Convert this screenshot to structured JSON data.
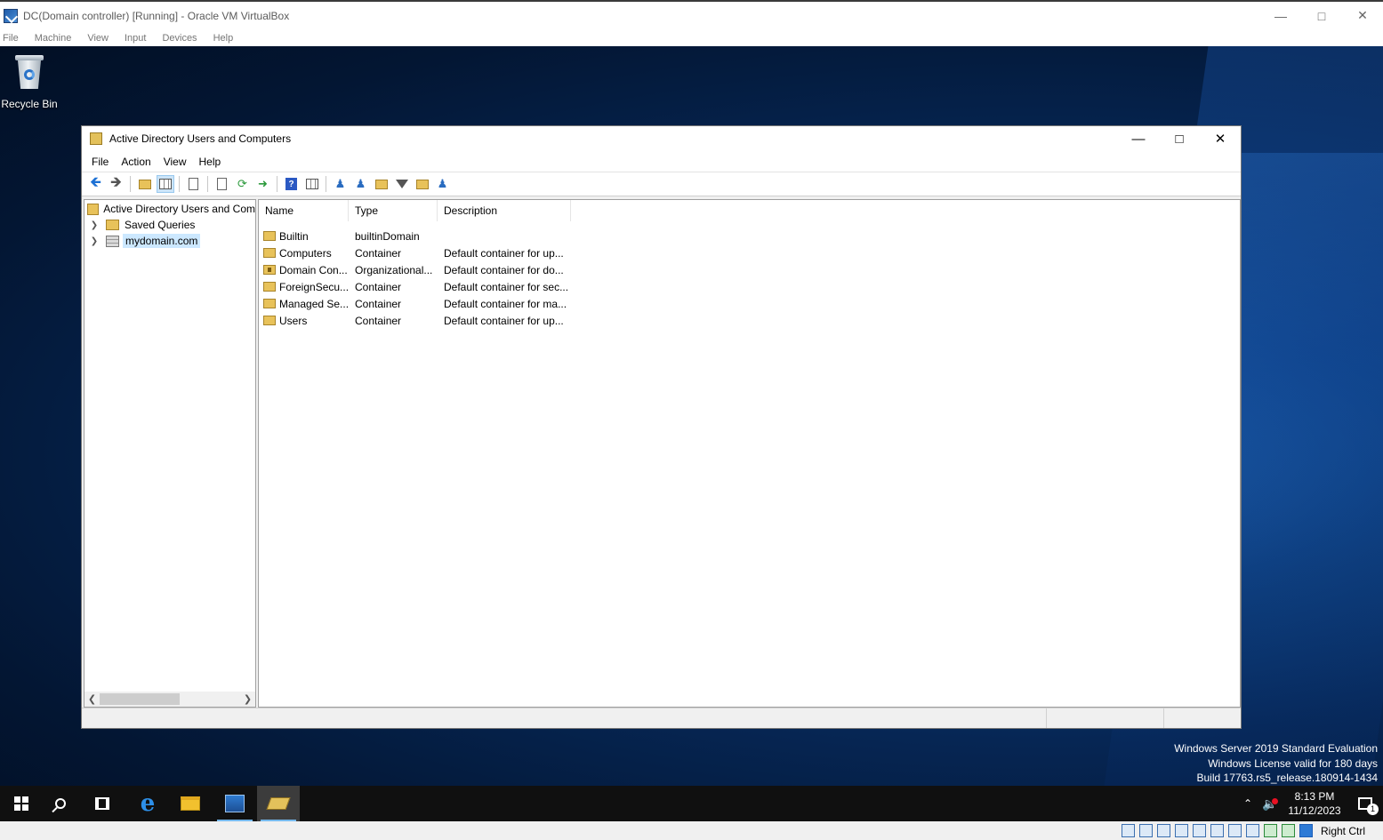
{
  "vbox": {
    "title": "DC(Domain controller)  [Running] - Oracle VM VirtualBox",
    "menu": [
      "File",
      "Machine",
      "View",
      "Input",
      "Devices",
      "Help"
    ],
    "host_key": "Right Ctrl"
  },
  "desktop": {
    "recycle_bin": "Recycle Bin",
    "watermark": {
      "line1": "Windows Server 2019 Standard Evaluation",
      "line2": "Windows License valid for 180 days",
      "line3": "Build 17763.rs5_release.180914-1434"
    }
  },
  "aduc": {
    "title": "Active Directory Users and Computers",
    "menu": [
      "File",
      "Action",
      "View",
      "Help"
    ],
    "tree": {
      "root": "Active Directory Users and Com",
      "items": [
        "Saved Queries",
        "mydomain.com"
      ]
    },
    "columns": [
      "Name",
      "Type",
      "Description"
    ],
    "rows": [
      {
        "name": "Builtin",
        "type": "builtinDomain",
        "description": ""
      },
      {
        "name": "Computers",
        "type": "Container",
        "description": "Default container for up..."
      },
      {
        "name": "Domain Con...",
        "type": "Organizational...",
        "description": "Default container for do..."
      },
      {
        "name": "ForeignSecu...",
        "type": "Container",
        "description": "Default container for sec..."
      },
      {
        "name": "Managed Se...",
        "type": "Container",
        "description": "Default container for ma..."
      },
      {
        "name": "Users",
        "type": "Container",
        "description": "Default container for up..."
      }
    ]
  },
  "taskbar": {
    "time": "8:13 PM",
    "date": "11/12/2023",
    "notification_count": "1"
  },
  "colors": {
    "selection": "#cce8ff",
    "folder": "#e8c25a",
    "taskbar": "#101010"
  }
}
